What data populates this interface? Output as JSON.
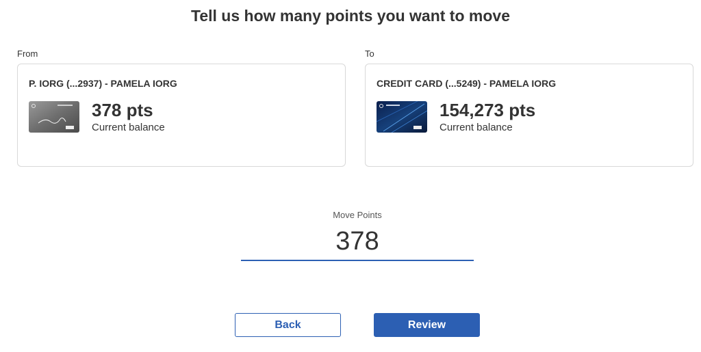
{
  "page": {
    "title": "Tell us how many points you want to move"
  },
  "from": {
    "label": "From",
    "account_name": "P. IORG (...2937) - PAMELA IORG",
    "balance": "378 pts",
    "caption": "Current balance",
    "card_icon": "credit-card-silver-icon"
  },
  "to": {
    "label": "To",
    "account_name": "CREDIT CARD (...5249) - PAMELA IORG",
    "balance": "154,273 pts",
    "caption": "Current balance",
    "card_icon": "credit-card-blue-icon"
  },
  "move": {
    "label": "Move Points",
    "value": "378"
  },
  "actions": {
    "back_label": "Back",
    "review_label": "Review"
  },
  "colors": {
    "accent": "#2c5fb3",
    "border": "#d8d8d8",
    "text": "#333333"
  }
}
